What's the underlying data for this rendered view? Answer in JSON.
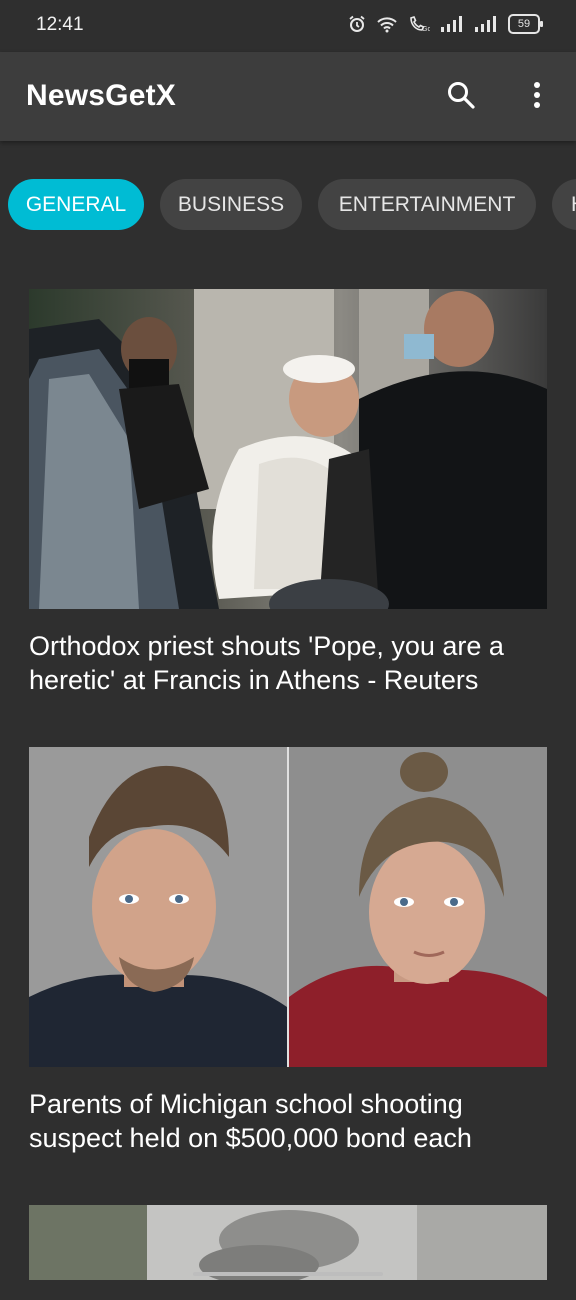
{
  "status_bar": {
    "time": "12:41",
    "battery": "59",
    "icons": [
      "alarm-icon",
      "wifi-icon",
      "wifi-calling-icon",
      "signal-icon",
      "signal-icon",
      "battery-icon"
    ]
  },
  "app_bar": {
    "title": "NewsGetX",
    "actions": [
      "search-icon",
      "more-vert-icon"
    ]
  },
  "categories": {
    "selected": "GENERAL",
    "items": [
      "GENERAL",
      "BUSINESS",
      "ENTERTAINMENT",
      "H"
    ]
  },
  "articles": [
    {
      "headline": "Orthodox priest shouts 'Pope, you are a heretic' at Francis in Athens - Reuters"
    },
    {
      "headline": "Parents of Michigan school shooting suspect held on $500,000 bond each"
    },
    {
      "headline": ""
    }
  ],
  "colors": {
    "background": "#2f2f2f",
    "app_bar": "#3d3d3d",
    "chip": "#434343",
    "chip_active": "#00bcd4"
  }
}
